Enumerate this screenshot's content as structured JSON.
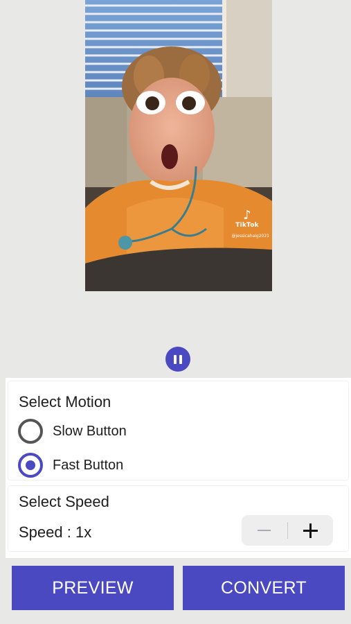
{
  "video": {
    "icon": "tiktok-logo-icon",
    "watermark": "TikTok",
    "handle": "@jessicahaig2021"
  },
  "playback": {
    "icon": "pause-icon"
  },
  "motion": {
    "title": "Select Motion",
    "options": [
      {
        "label": "Slow Button",
        "selected": false
      },
      {
        "label": "Fast Button",
        "selected": true
      }
    ]
  },
  "speed": {
    "title": "Select Speed",
    "value_text": "Speed : 1x",
    "decrement_icon": "minus-icon",
    "increment_icon": "plus-icon"
  },
  "actions": {
    "preview": "PREVIEW",
    "convert": "CONVERT"
  },
  "colors": {
    "accent": "#4b49c2",
    "background": "#e8e8e7",
    "surface": "#ffffff"
  }
}
